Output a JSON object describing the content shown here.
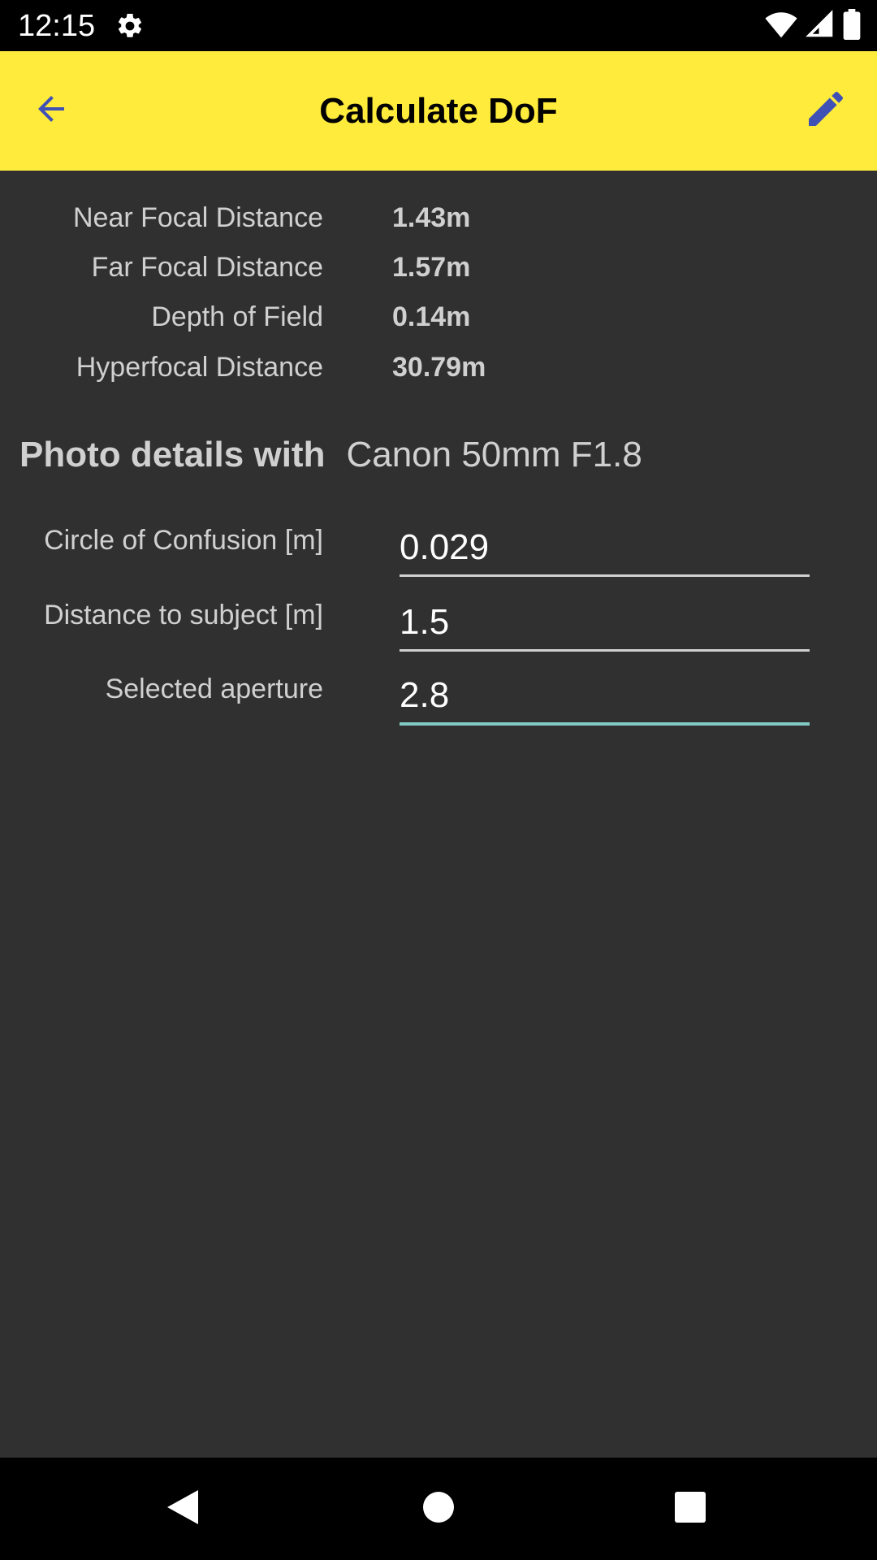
{
  "status_bar": {
    "time": "12:15"
  },
  "app_bar": {
    "title": "Calculate DoF",
    "color": "#ffeb3b",
    "icon_color": "#3f51b5"
  },
  "results": [
    {
      "label": "Near Focal Distance",
      "value": "1.43m"
    },
    {
      "label": "Far Focal Distance",
      "value": "1.57m"
    },
    {
      "label": "Depth of Field",
      "value": "0.14m"
    },
    {
      "label": "Hyperfocal Distance",
      "value": "30.79m"
    }
  ],
  "photo_details": {
    "title": "Photo details with",
    "lens": "Canon 50mm F1.8"
  },
  "fields": [
    {
      "label": "Circle of Confusion [m]",
      "value": "0.029"
    },
    {
      "label": "Distance to subject [m]",
      "value": "1.5"
    },
    {
      "label": "Selected aperture",
      "value": "2.8"
    }
  ],
  "accent_color": "#80cbc4"
}
